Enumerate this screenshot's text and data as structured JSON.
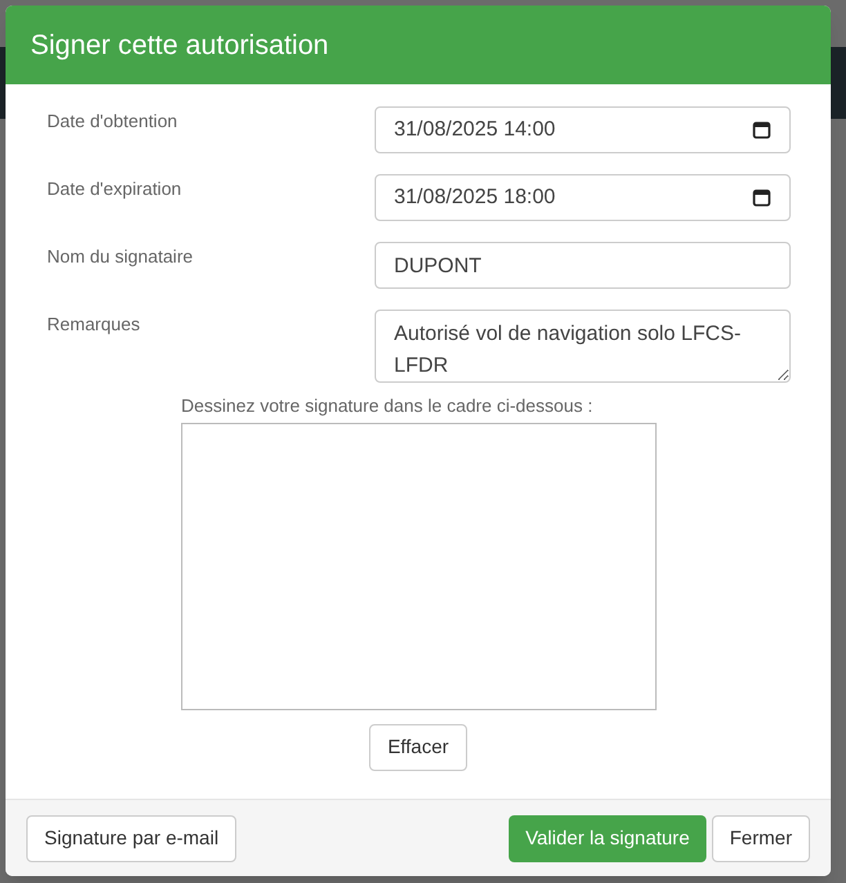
{
  "dialog": {
    "title": "Signer cette autorisation"
  },
  "fields": [
    {
      "kind": "datetime",
      "label": "Date d'obtention",
      "value": "31/08/2025 14:00"
    },
    {
      "kind": "datetime",
      "label": "Date d'expiration",
      "value": "31/08/2025 18:00"
    },
    {
      "kind": "text",
      "label": "Nom du signataire",
      "value": "DUPONT"
    },
    {
      "kind": "textarea",
      "label": "Remarques",
      "value": "Autorisé vol de navigation solo LFCS-LFDR"
    }
  ],
  "signature": {
    "instruction": "Dessinez votre signature dans le cadre ci-dessous :",
    "clear_button": "Effacer"
  },
  "footer": {
    "left_button": "Signature par e-mail",
    "primary_button": "Valider la signature",
    "close_button": "Fermer"
  }
}
